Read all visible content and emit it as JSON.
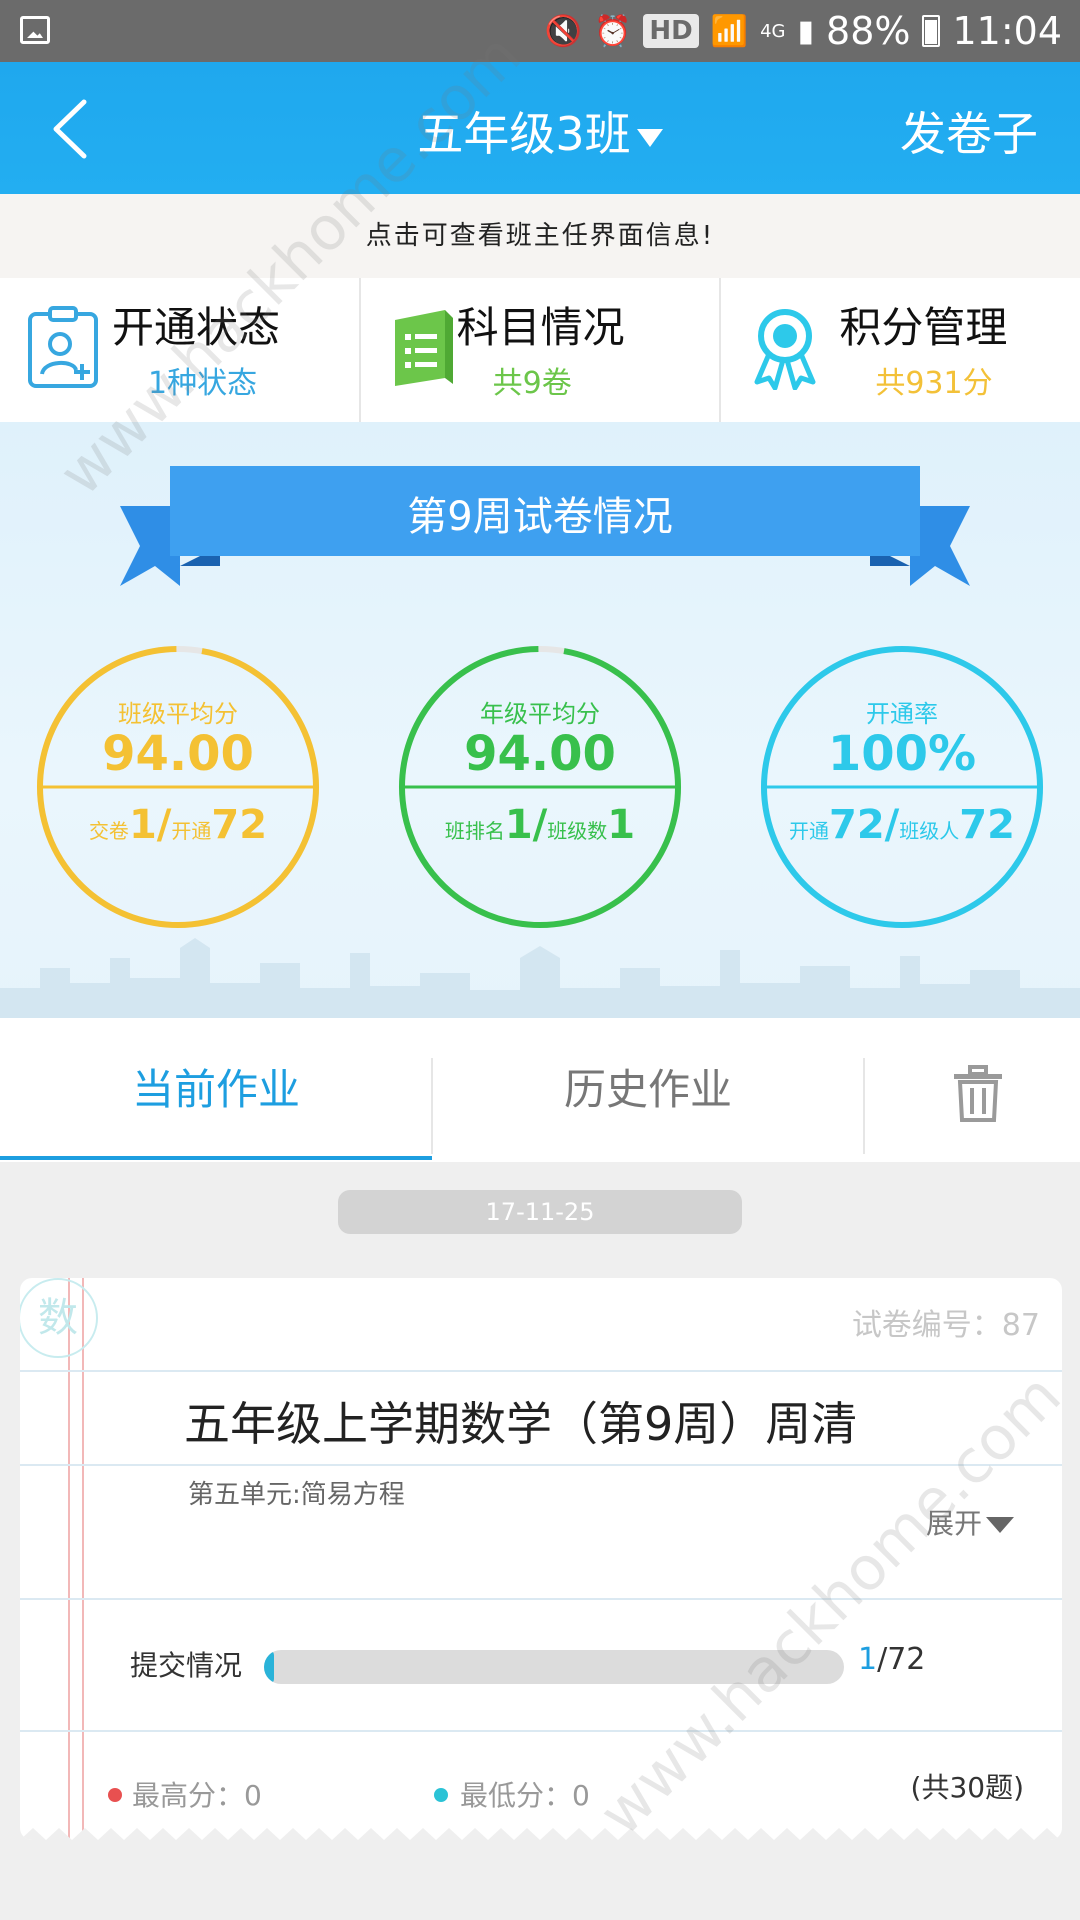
{
  "status_bar": {
    "hd": "HD",
    "network": "4G",
    "battery": "88%",
    "time": "11:04"
  },
  "header": {
    "class_name": "五年级3班",
    "send_paper": "发卷子"
  },
  "info_strip": "点击可查看班主任界面信息!",
  "stats": [
    {
      "title": "开通状态",
      "sub": "1种状态",
      "color": "#37a7e0",
      "icon": "badge-user-icon"
    },
    {
      "title": "科目情况",
      "sub": "共9卷",
      "color": "#6cc64a",
      "icon": "book-icon"
    },
    {
      "title": "积分管理",
      "sub": "共931分",
      "color": "#f3c138",
      "icon": "award-ribbon-icon"
    }
  ],
  "banner": {
    "title": "第9周试卷情况"
  },
  "rings": [
    {
      "label": "班级平均分",
      "value": "94.00",
      "b1_label": "交卷",
      "b1_value": "1/",
      "b2_label": "开通",
      "b2_value": "72",
      "color": "#f4c133",
      "progress": 0.97
    },
    {
      "label": "年级平均分",
      "value": "94.00",
      "b1_label": "班排名",
      "b1_value": "1/",
      "b2_label": "班级数",
      "b2_value": "1",
      "color": "#38c04c",
      "progress": 0.97
    },
    {
      "label": "开通率",
      "value": "100%",
      "b1_label": "开通",
      "b1_value": "72/",
      "b2_label": "班级人",
      "b2_value": "72",
      "color": "#2dc9ea",
      "progress": 1.0
    }
  ],
  "tabs": {
    "current": "当前作业",
    "history": "历史作业"
  },
  "date": "17-11-25",
  "card": {
    "stamp": "数",
    "paper_number": "试卷编号：87",
    "title": "五年级上学期数学（第9周）周清",
    "unit": "第五单元:简易方程",
    "expand": "展开",
    "submit_label": "提交情况",
    "submitted": "1",
    "total": "/72",
    "submit_progress": 0.014,
    "max_score": "最高分：0",
    "min_score": "最低分：0",
    "question_count": "(共30题)",
    "max_color": "#e85050",
    "min_color": "#2bc3d6"
  },
  "watermark": "www.hackhome.com"
}
